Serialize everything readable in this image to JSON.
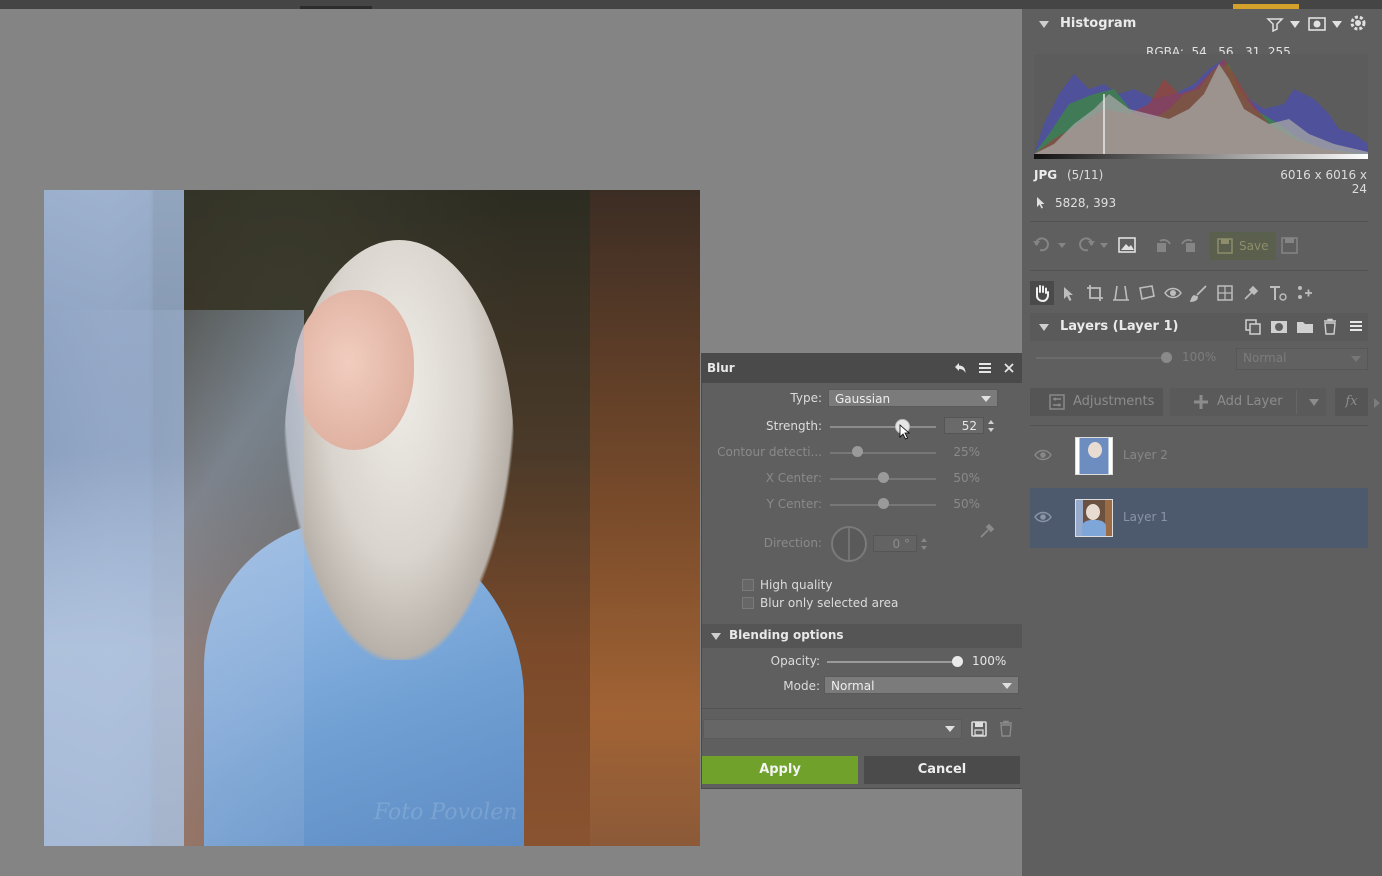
{
  "blur": {
    "title": "Blur",
    "type_label": "Type:",
    "type_value": "Gaussian",
    "strength_label": "Strength:",
    "strength_value": "52",
    "strength_level": 0.52,
    "contour_label": "Contour detecti...",
    "contour_value": "25%",
    "contour_level": 0.25,
    "xcenter_label": "X Center:",
    "xcenter_value": "50%",
    "xcenter_level": 0.5,
    "ycenter_label": "Y Center:",
    "ycenter_value": "50%",
    "ycenter_level": 0.5,
    "direction_label": "Direction:",
    "direction_value": "0 °",
    "high_quality_label": "High quality",
    "blur_selected_label": "Blur only selected area",
    "blending_title": "Blending options",
    "opacity_label": "Opacity:",
    "opacity_value": "100%",
    "opacity_level": 1.0,
    "mode_label": "Mode:",
    "mode_value": "Normal",
    "apply_label": "Apply",
    "cancel_label": "Cancel"
  },
  "histogram": {
    "title": "Histogram",
    "rgba": "RGBA:  54,  56,  31, 255",
    "format": "JPG",
    "index": "(5/11)",
    "dimensions": "6016 x 6016 x 24",
    "coords": "5828, 393"
  },
  "toolbar": {
    "save_label": "Save"
  },
  "layers": {
    "title": "Layers (Layer 1)",
    "opacity_value": "100%",
    "mode_value": "Normal",
    "adjustments_label": "Adjustments",
    "add_layer_label": "Add Layer",
    "fx_label": "fx",
    "items": [
      {
        "name": "Layer 2"
      },
      {
        "name": "Layer 1"
      }
    ]
  },
  "photo": {
    "watermark": "Foto Povolen"
  },
  "colors": {
    "accent": "#6fa12b",
    "selected_layer": "#4d5a6e",
    "panel": "#5f5f5f",
    "canvas": "#838383"
  }
}
